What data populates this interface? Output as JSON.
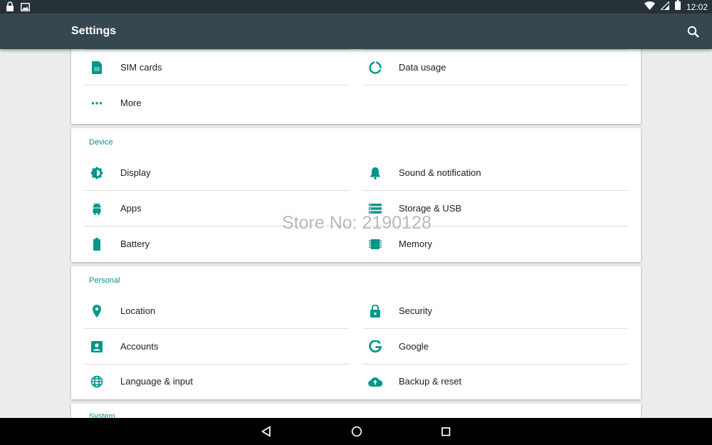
{
  "status_bar": {
    "time": "12:02"
  },
  "app_bar": {
    "title": "Settings"
  },
  "cards": {
    "network": {
      "items": [
        {
          "label": "SIM cards",
          "icon": "sim-card-icon"
        },
        {
          "label": "Data usage",
          "icon": "data-usage-icon"
        },
        {
          "label": "More",
          "icon": "more-horiz-icon"
        }
      ]
    },
    "device": {
      "header": "Device",
      "items": [
        {
          "label": "Display",
          "icon": "display-brightness-icon"
        },
        {
          "label": "Sound & notification",
          "icon": "bell-icon"
        },
        {
          "label": "Apps",
          "icon": "android-icon"
        },
        {
          "label": "Storage & USB",
          "icon": "storage-icon"
        },
        {
          "label": "Battery",
          "icon": "battery-icon"
        },
        {
          "label": "Memory",
          "icon": "memory-chip-icon"
        }
      ]
    },
    "personal": {
      "header": "Personal",
      "items": [
        {
          "label": "Location",
          "icon": "location-pin-icon"
        },
        {
          "label": "Security",
          "icon": "lock-icon"
        },
        {
          "label": "Accounts",
          "icon": "account-box-icon"
        },
        {
          "label": "Google",
          "icon": "google-g-icon"
        },
        {
          "label": "Language & input",
          "icon": "globe-icon"
        },
        {
          "label": "Backup & reset",
          "icon": "cloud-upload-icon"
        }
      ]
    },
    "system": {
      "header": "System"
    }
  },
  "watermark": "Store No: 2190128",
  "colors": {
    "accent": "#009688",
    "app_bar": "#37474f",
    "status_bar": "#263238"
  }
}
